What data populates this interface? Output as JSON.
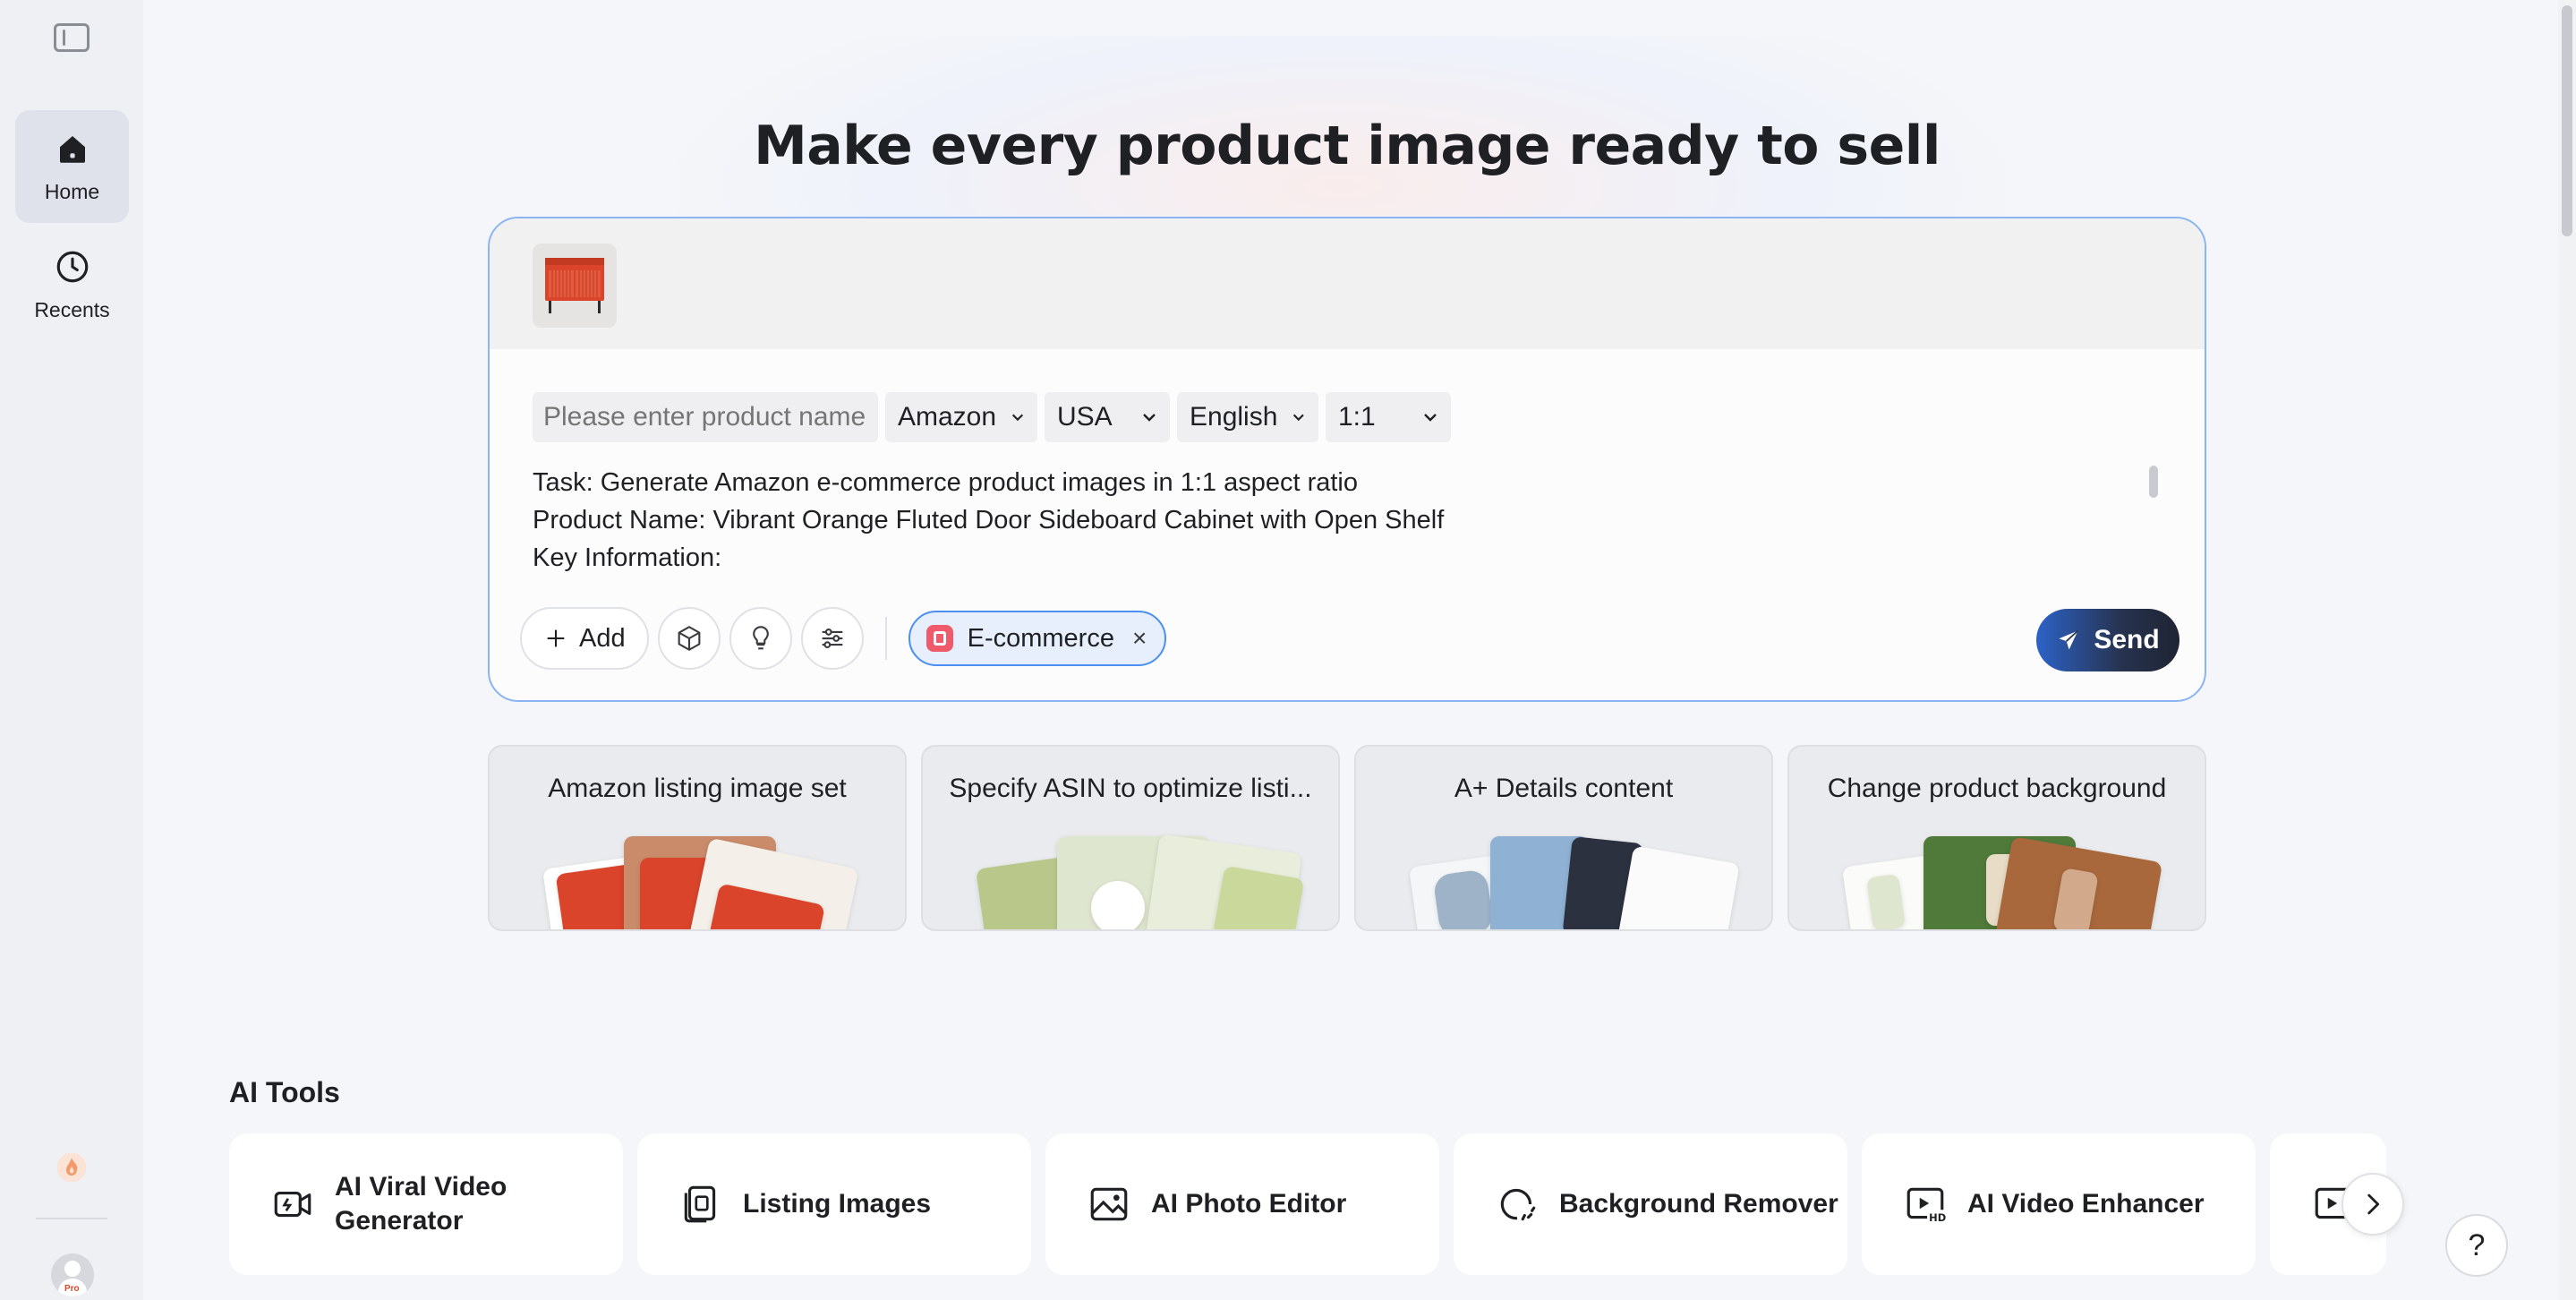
{
  "sidebar": {
    "toggle_icon": "sidebar-toggle-icon",
    "items": [
      {
        "label": "Home",
        "icon": "home-icon",
        "active": true
      },
      {
        "label": "Recents",
        "icon": "clock-icon",
        "active": false
      }
    ],
    "avatar_badge": "Pro"
  },
  "hero": {
    "headline": "Make every product image ready to sell"
  },
  "composer": {
    "product_name_placeholder": "Please enter product name",
    "platform": "Amazon",
    "country": "USA",
    "language": "English",
    "aspect_ratio": "1:1",
    "prompt_lines": [
      "Task: Generate Amazon e-commerce product images in 1:1 aspect ratio",
      "Product Name: Vibrant Orange Fluted Door Sideboard Cabinet with Open Shelf",
      "Key Information:"
    ],
    "add_label": "Add",
    "chip_label": "E-commerce",
    "chip_close": "×",
    "send_label": "Send"
  },
  "suggestions": [
    {
      "title": "Amazon listing image set"
    },
    {
      "title": "Specify ASIN to optimize listi..."
    },
    {
      "title": "A+ Details content"
    },
    {
      "title": "Change product background"
    }
  ],
  "ai_tools": {
    "title": "AI Tools",
    "items": [
      {
        "label": "AI Viral Video Generator",
        "icon": "video-camera-icon"
      },
      {
        "label": "Listing Images",
        "icon": "listing-images-icon"
      },
      {
        "label": "AI Photo Editor",
        "icon": "photo-editor-icon"
      },
      {
        "label": "Background Remover",
        "icon": "background-remover-icon"
      },
      {
        "label": "AI Video Enhancer",
        "icon": "hd-video-icon"
      }
    ]
  },
  "help_label": "?",
  "colors": {
    "accent": "#4b8ff0",
    "send_gradient_start": "#2c63c7",
    "send_gradient_end": "#1f2433",
    "furniture_orange": "#d9442b"
  }
}
